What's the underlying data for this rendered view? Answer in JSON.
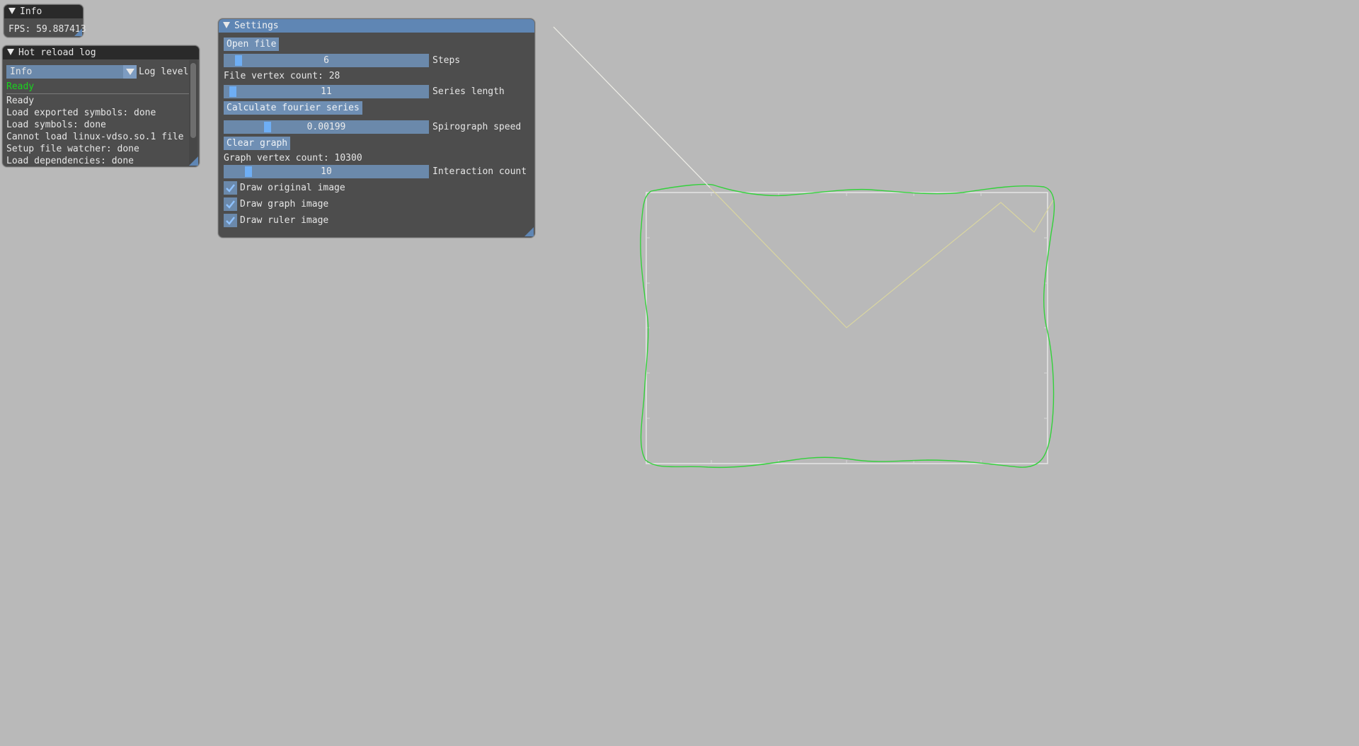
{
  "info_window": {
    "title": "Info",
    "fps_text": "FPS: 59.887413"
  },
  "log_window": {
    "title": "Hot reload log",
    "log_level_value": "Info",
    "log_level_label": "Log level",
    "status": "Ready",
    "status_color": "#19d41e",
    "entries": [
      "Ready",
      "Load exported symbols: done",
      "Load symbols: done",
      "Cannot load linux-vdso.so.1 file",
      "Setup file watcher: done",
      "Load dependencies: done"
    ]
  },
  "settings_window": {
    "title": "Settings",
    "open_file_label": "Open file",
    "steps": {
      "value": "6",
      "label": "Steps",
      "fraction": 0.05
    },
    "file_vertex_count": "File vertex count: 28",
    "series_length": {
      "value": "11",
      "label": "Series length",
      "fraction": 0.02
    },
    "calculate_label": "Calculate fourier series",
    "spirograph_speed": {
      "value": "0.00199",
      "label": "Spirograph speed",
      "fraction": 0.2
    },
    "clear_graph_label": "Clear graph",
    "graph_vertex_count": "Graph vertex count: 10300",
    "interaction_count": {
      "value": "10",
      "label": "Interaction count",
      "fraction": 0.1
    },
    "draw_original_label": "Draw original image",
    "draw_original_checked": true,
    "draw_graph_label": "Draw graph image",
    "draw_graph_checked": true,
    "draw_ruler_label": "Draw ruler image",
    "draw_ruler_checked": true
  },
  "colors": {
    "background": "#b9b9b9",
    "accent": "#5f86b4",
    "graph_line": "#33d13b",
    "original_line": "#e8e8e8",
    "spirograph_line": "#dad6a0"
  }
}
